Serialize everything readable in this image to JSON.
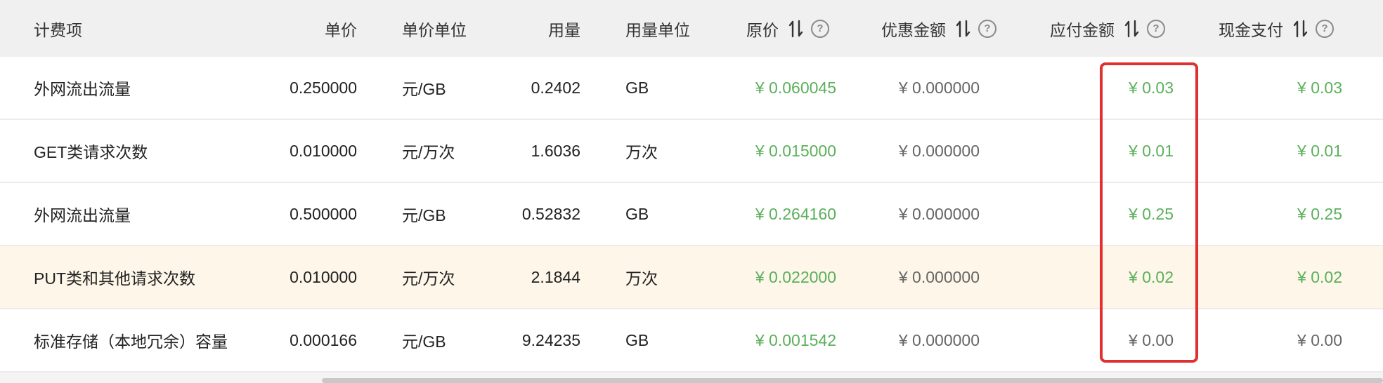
{
  "columns": {
    "item": "计费项",
    "unit_price": "单价",
    "unit_price_unit": "单价单位",
    "usage": "用量",
    "usage_unit": "用量单位",
    "original_price": "原价",
    "discount": "优惠金额",
    "payable": "应付金额",
    "cash": "现金支付"
  },
  "help_glyph": "?",
  "rows": [
    {
      "item": "外网流出流量",
      "unit_price": "0.250000",
      "unit_price_unit": "元/GB",
      "usage": "0.2402",
      "usage_unit": "GB",
      "original_price": "¥ 0.060045",
      "discount": "¥ 0.000000",
      "payable": "¥ 0.03",
      "cash": "¥ 0.03"
    },
    {
      "item": "GET类请求次数",
      "unit_price": "0.010000",
      "unit_price_unit": "元/万次",
      "usage": "1.6036",
      "usage_unit": "万次",
      "original_price": "¥ 0.015000",
      "discount": "¥ 0.000000",
      "payable": "¥ 0.01",
      "cash": "¥ 0.01"
    },
    {
      "item": "外网流出流量",
      "unit_price": "0.500000",
      "unit_price_unit": "元/GB",
      "usage": "0.52832",
      "usage_unit": "GB",
      "original_price": "¥ 0.264160",
      "discount": "¥ 0.000000",
      "payable": "¥ 0.25",
      "cash": "¥ 0.25"
    },
    {
      "item": "PUT类和其他请求次数",
      "unit_price": "0.010000",
      "unit_price_unit": "元/万次",
      "usage": "2.1844",
      "usage_unit": "万次",
      "original_price": "¥ 0.022000",
      "discount": "¥ 0.000000",
      "payable": "¥ 0.02",
      "cash": "¥ 0.02"
    },
    {
      "item": "标准存储（本地冗余）容量",
      "unit_price": "0.000166",
      "unit_price_unit": "元/GB",
      "usage": "9.24235",
      "usage_unit": "GB",
      "original_price": "¥ 0.001542",
      "discount": "¥ 0.000000",
      "payable": "¥ 0.00",
      "cash": "¥ 0.00"
    }
  ],
  "colors": {
    "header_bg": "#f0f0f0",
    "highlight_row_bg": "#fdf6e9",
    "money_positive": "#5bb05b",
    "money_zero": "#666666",
    "callout_border": "#e0302f"
  },
  "icons": {
    "sort": "sort-icon",
    "help": "help-icon"
  }
}
